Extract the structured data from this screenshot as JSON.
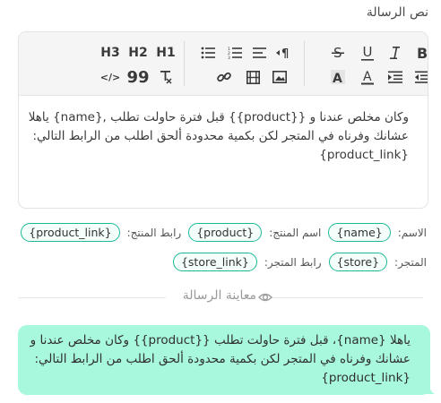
{
  "message_label": "نص الرسالة",
  "toolbar": {
    "buttons": [
      "H3",
      "H2",
      "H1",
      "bulleted-list",
      "numbered-list",
      "align",
      "paragraph-direction",
      "strikethrough",
      "underline",
      "italic",
      "bold",
      "code",
      "quote",
      "clear-format",
      "link",
      "video",
      "image",
      "highlight",
      "font-color",
      "indent",
      "outdent"
    ],
    "h3": "H3",
    "h2": "H2",
    "h1": "H1",
    "quote": "99",
    "code": "</>"
  },
  "editor": {
    "line1": "وكان مخلص عندنا و {{product}} قبل فترة حاولت تطلب ,{name} ياهلا",
    "line2": "عشانك وفرناه في المتجر لكن بكمية محدودة ألحق اطلب من الرابط التالي:",
    "line3": "{product_link}"
  },
  "variables": {
    "name_label": "الاسم:",
    "name_chip": "{name}",
    "product_label": "اسم المنتج:",
    "product_chip": "{product}",
    "product_link_label": "رابط المنتج:",
    "product_link_chip": "{product_link}",
    "store_label": "المتجر:",
    "store_chip": "{store}",
    "store_link_label": "رابط المتجر:",
    "store_link_chip": "{store_link}"
  },
  "preview": {
    "title": "معاينة الرسالة",
    "line1": "ياهلا {name}، قبل فترة حاولت تطلب {{product}} وكان مخلص عندنا و",
    "line2": "عشانك وفرناه في المتجر لكن بكمية محدودة ألحق اطلب من الرابط التالي:",
    "line3": "{product_link}"
  },
  "colors": {
    "chip_border": "#1bb897",
    "bubble": "#a8f8de"
  }
}
